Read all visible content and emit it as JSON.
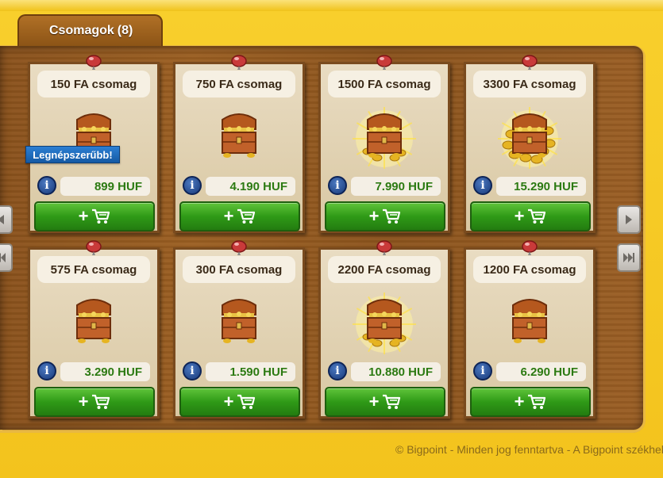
{
  "tab": {
    "label": "Csomagok",
    "count": "(8)"
  },
  "popular_badge": "Legnépszerűbb!",
  "packages": [
    {
      "name": "150 FA csomag",
      "price": "899 HUF",
      "popular": true,
      "chest": "small"
    },
    {
      "name": "750 FA csomag",
      "price": "4.190 HUF",
      "popular": false,
      "chest": "small"
    },
    {
      "name": "1500 FA csomag",
      "price": "7.990 HUF",
      "popular": false,
      "chest": "glow"
    },
    {
      "name": "3300 FA csomag",
      "price": "15.290 HUF",
      "popular": false,
      "chest": "pile"
    },
    {
      "name": "575 FA csomag",
      "price": "3.290 HUF",
      "popular": false,
      "chest": "small"
    },
    {
      "name": "300 FA csomag",
      "price": "1.590 HUF",
      "popular": false,
      "chest": "small"
    },
    {
      "name": "2200 FA csomag",
      "price": "10.880 HUF",
      "popular": false,
      "chest": "glow"
    },
    {
      "name": "1200 FA csomag",
      "price": "6.290 HUF",
      "popular": false,
      "chest": "small"
    }
  ],
  "info_glyph": "i",
  "buy_button": {
    "plus": "+",
    "icon": "cart-icon"
  },
  "footer": {
    "text": "© Bigpoint - Minden jog fenntartva - A Bigpoint székhelye"
  },
  "colors": {
    "price_green": "#2c7a12",
    "badge_blue": "#1e6cc0",
    "button_green": "#2f9a17"
  }
}
